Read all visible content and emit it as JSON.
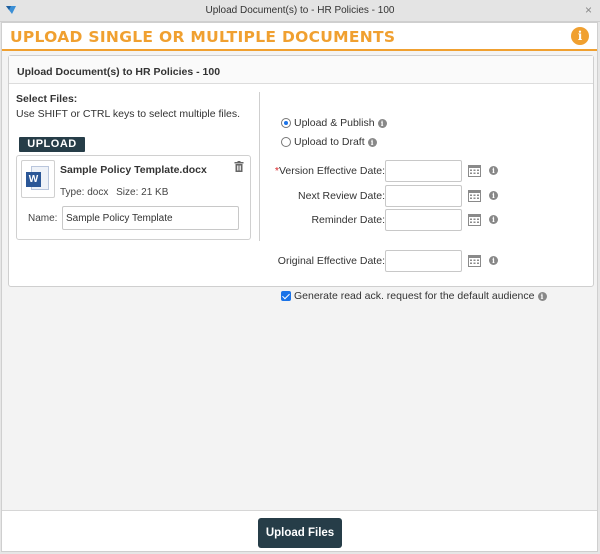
{
  "window": {
    "title": "Upload Document(s) to - HR Policies - 100",
    "close_glyph": "×"
  },
  "heading": {
    "text": "UPLOAD SINGLE OR MULTIPLE DOCUMENTS",
    "info_glyph": "i",
    "accent_color": "#f0a030"
  },
  "panel": {
    "title": "Upload Document(s) to HR Policies - 100"
  },
  "select_files": {
    "label": "Select Files:",
    "hint": "Use SHIFT or CTRL keys to select multiple files.",
    "upload_button": "UPLOAD"
  },
  "file": {
    "icon_letter": "W",
    "name": "Sample Policy Template.docx",
    "type_text": "Type: docx",
    "size_text": "Size: 21 KB",
    "name_label": "Name:",
    "name_value": "Sample Policy Template"
  },
  "options": {
    "upload_publish": "Upload & Publish",
    "upload_draft": "Upload to Draft",
    "selected": "upload_publish"
  },
  "dates": [
    {
      "label": "Version Effective Date:",
      "required": true,
      "required_mark": "*",
      "value": ""
    },
    {
      "label": "Next Review Date:",
      "required": false,
      "value": ""
    },
    {
      "label": "Reminder Date:",
      "required": false,
      "value": ""
    },
    {
      "label": "Original Effective Date:",
      "required": false,
      "value": ""
    }
  ],
  "ack": {
    "label": "Generate read ack. request for the default audience",
    "checked": true
  },
  "footer": {
    "upload_files_button": "Upload Files",
    "button_color": "#263d48"
  },
  "icons": {
    "info": "i"
  }
}
